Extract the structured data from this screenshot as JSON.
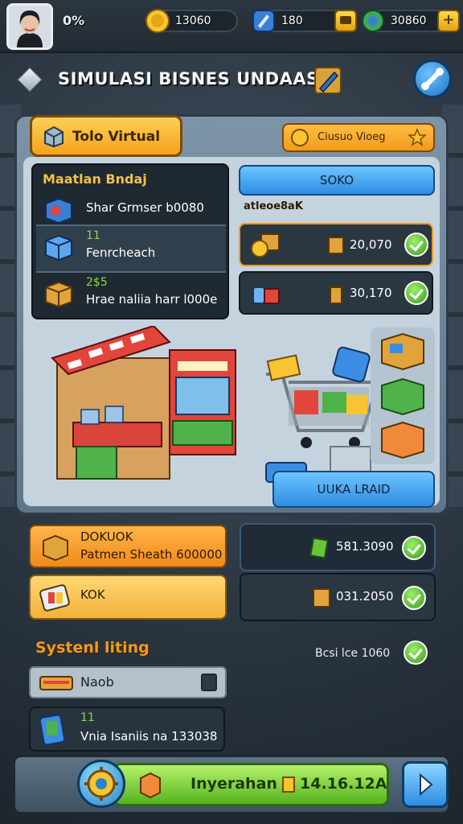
{
  "topbar": {
    "level": "0%",
    "coins": "13060",
    "gems": "180",
    "cash": "30860",
    "plus": "+"
  },
  "title": "SIMULASI BISNES UNDAASIA",
  "panel": {
    "tab_label": "Tolo Virtual",
    "bonus_label": "Ciusuo Vioeg",
    "list_title": "Maatlan Bndaj",
    "list": [
      {
        "line1": "",
        "line2": "Shar Grmser b0080"
      },
      {
        "line1": "11",
        "line2": "Fenrcheach"
      },
      {
        "line1": "2$5",
        "line2": "Hrae naliia harr l000e"
      }
    ],
    "soko_button": "SOKO",
    "sub_label": "atleoe8aK",
    "prices": [
      "20,070",
      "30,170"
    ],
    "open_button": "UUKA LRAID"
  },
  "lower": {
    "orange_title": "DOKUOK",
    "orange_sub": "Patmen Sheath 600000",
    "yellow_title": "KOK",
    "green_value": "581.3090",
    "orange_value": "031.2050",
    "sys_title": "Systenl liting",
    "sys_right": "Bcsi lce 1060",
    "input_label": "Naob",
    "dark_line1": "11",
    "dark_line2": "Vnia Isaniis na 133038"
  },
  "bottom": {
    "main_label": "Inyerahan",
    "main_value": "14.16.12A"
  }
}
